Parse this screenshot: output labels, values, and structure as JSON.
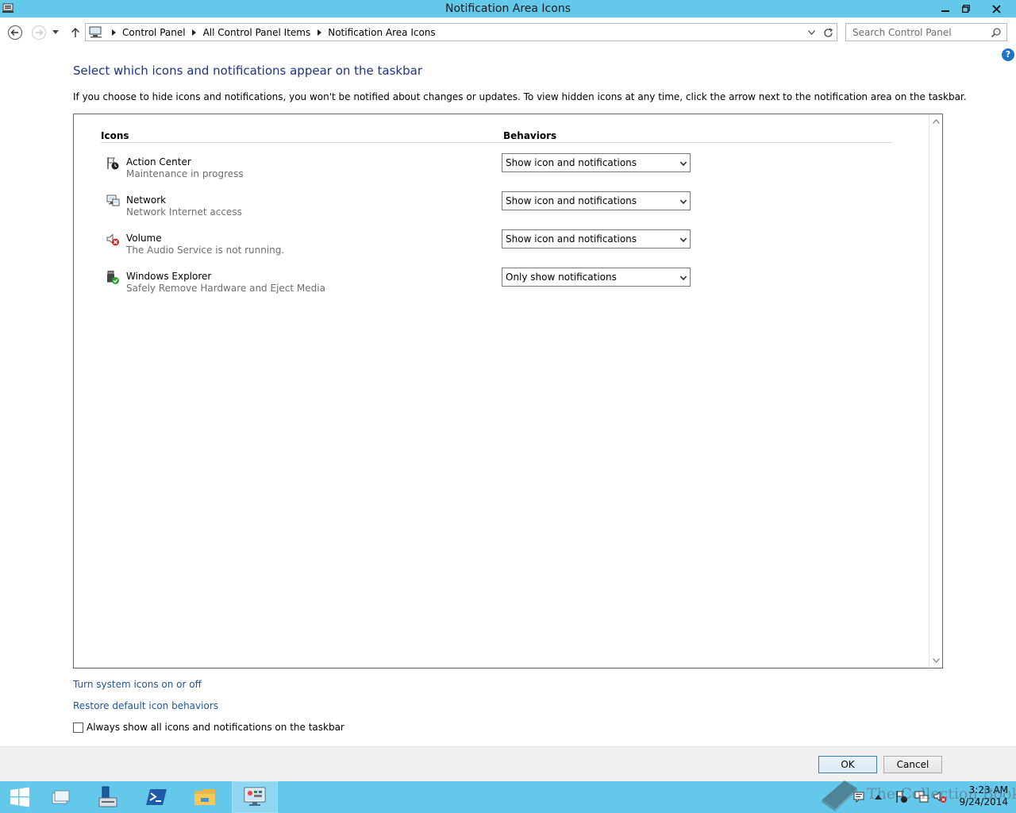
{
  "window": {
    "title": "Notification Area Icons"
  },
  "address_bar": {
    "crumbs": [
      "Control Panel",
      "All Control Panel Items",
      "Notification Area Icons"
    ]
  },
  "search": {
    "placeholder": "Search Control Panel"
  },
  "help_label": "?",
  "main": {
    "heading": "Select which icons and notifications appear on the taskbar",
    "description": "If you choose to hide icons and notifications, you won't be notified about changes or updates. To view hidden icons at any time, click the arrow next to the notification area on the taskbar.",
    "col_icons": "Icons",
    "col_behaviors": "Behaviors",
    "rows": [
      {
        "name": "Action Center",
        "subtitle": "Maintenance in progress",
        "behavior": "Show icon and notifications",
        "icon": "action-center-flag-icon"
      },
      {
        "name": "Network",
        "subtitle": "Network Internet access",
        "behavior": "Show icon and notifications",
        "icon": "network-icon"
      },
      {
        "name": "Volume",
        "subtitle": "The Audio Service is not running.",
        "behavior": "Show icon and notifications",
        "icon": "volume-muted-icon"
      },
      {
        "name": "Windows Explorer",
        "subtitle": "Safely Remove Hardware and Eject Media",
        "behavior": "Only show notifications",
        "icon": "usb-safely-remove-icon"
      }
    ],
    "link_system_icons": "Turn system icons on or off",
    "link_restore": "Restore default icon behaviors",
    "always_show_label": "Always show all icons and notifications on the taskbar",
    "always_show_checked": false
  },
  "footer": {
    "ok": "OK",
    "cancel": "Cancel"
  },
  "taskbar": {
    "items": [
      "start-icon",
      "task-view-icon",
      "server-manager-icon",
      "powershell-icon",
      "file-explorer-icon",
      "control-panel-icon"
    ],
    "clock_time": "3:23 AM",
    "clock_date": "9/24/2014"
  },
  "watermark": "The Collection Book",
  "colors": {
    "titlebar": "#63c8ea",
    "heading": "#1e3287",
    "link": "#1e56a0"
  }
}
